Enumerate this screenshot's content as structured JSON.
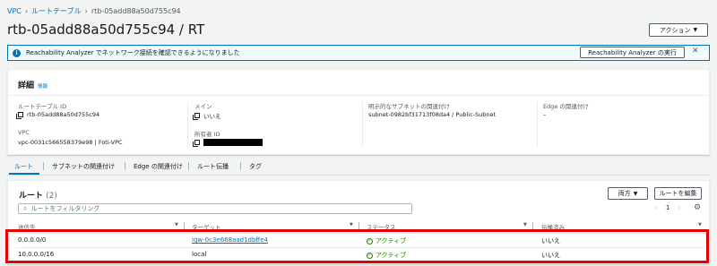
{
  "breadcrumb": {
    "items": [
      "VPC",
      "ルートテーブル"
    ],
    "current": "rtb-05add88a50d755c94"
  },
  "page_title": "rtb-05add88a50d755c94 / RT",
  "actions_button": "アクション",
  "banner": {
    "message": "Reachability Analyzer でネットワーク接続を確認できるようになりました",
    "button": "Reachability Analyzer の実行"
  },
  "details": {
    "heading": "詳細",
    "info_link": "情報",
    "route_table_id_label": "ルートテーブル ID",
    "route_table_id": "rtb-05add88a50d755c94",
    "main_label": "メイン",
    "main_value": "いいえ",
    "explicit_subnet_label": "明示的なサブネットの関連付け",
    "explicit_subnet_value": "subnet-0982bf31713f08da4 / Public-Subnet",
    "edge_label": "Edge の関連付け",
    "edge_value": "–",
    "vpc_label": "VPC",
    "vpc_value": "vpc-0031c566558379e98 | Foti-VPC",
    "owner_label": "所有者 ID"
  },
  "tabs": [
    "ルート",
    "サブネットの関連付け",
    "Edge の関連付け",
    "ルート伝播",
    "タグ"
  ],
  "routes": {
    "heading": "ルート",
    "count": "(2)",
    "both_button": "両方",
    "edit_button": "ルートを編集",
    "filter_placeholder": "ルートをフィルタリング",
    "page": "1",
    "columns": [
      "送信先",
      "ターゲット",
      "ステータス",
      "伝播済み"
    ],
    "rows": [
      {
        "destination": "0.0.0.0/0",
        "target": "igw-0c3e668aad1dbffe4",
        "status": "アクティブ",
        "propagated": "いいえ"
      },
      {
        "destination": "10.0.0.0/16",
        "target": "local",
        "status": "アクティブ",
        "propagated": "いいえ"
      }
    ]
  },
  "colors": {
    "link": "#0073bb",
    "active": "#1d8102",
    "highlight": "#e60000"
  }
}
